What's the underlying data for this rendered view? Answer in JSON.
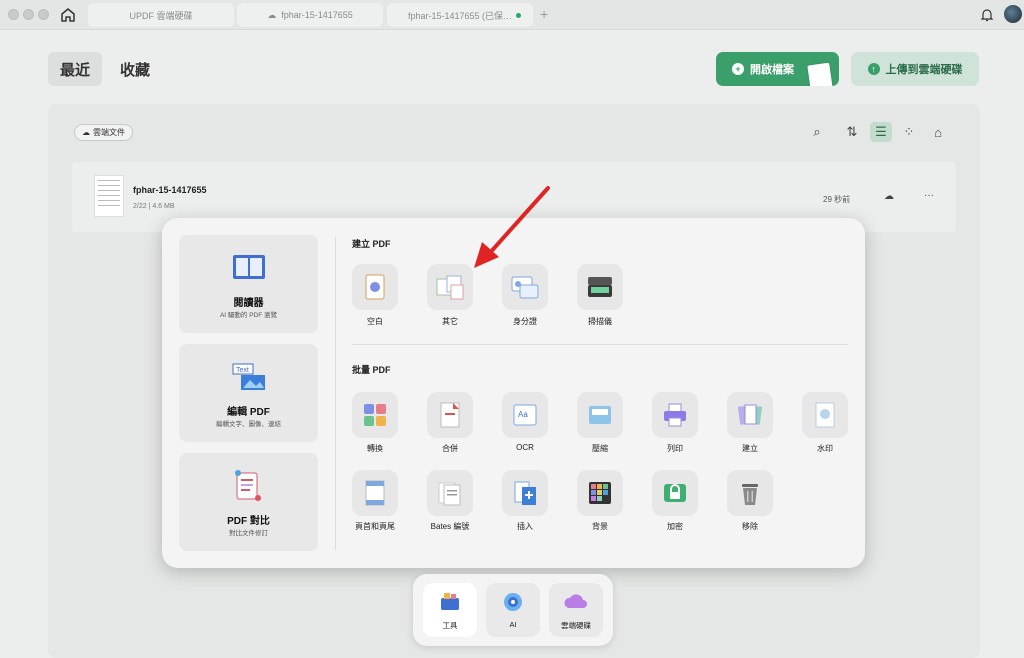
{
  "titlebar": {
    "tabs": [
      "UPDF 雲端硬碟",
      "fphar-15-1417655",
      "fphar-15-1417655 (已保…"
    ],
    "add_tab": "+"
  },
  "header": {
    "tabs": [
      "最近",
      "收藏"
    ],
    "open_button": "開啟檔案",
    "upload_button": "上傳到雲端硬碟"
  },
  "filelist": {
    "cloud_chip": "雲端文件",
    "file": {
      "name": "fphar-15-1417655",
      "meta": "2/22 | 4.6 MB",
      "time": "29 秒前"
    }
  },
  "tools": {
    "left_cards": [
      {
        "title": "閱讀器",
        "subtitle": "AI 驅動的 PDF 瀏覽"
      },
      {
        "title": "編輯 PDF",
        "subtitle": "編輯文字、圖像、連結"
      },
      {
        "title": "PDF 對比",
        "subtitle": "對比文件修訂"
      }
    ],
    "create_title": "建立 PDF",
    "create_items": [
      "空白",
      "其它",
      "身分證",
      "掃描儀"
    ],
    "batch_title": "批量 PDF",
    "batch_row1": [
      "轉換",
      "合併",
      "OCR",
      "壓縮",
      "列印",
      "建立",
      "水印"
    ],
    "batch_row2": [
      "頁首和頁尾",
      "Bates 編號",
      "插入",
      "背景",
      "加密",
      "移除"
    ]
  },
  "dock": {
    "items": [
      "工具",
      "AI",
      "雲端硬碟"
    ]
  },
  "colors": {
    "accent": "#3a9f6a",
    "accent_light": "#cfe3d8",
    "arrow": "#e02424"
  }
}
